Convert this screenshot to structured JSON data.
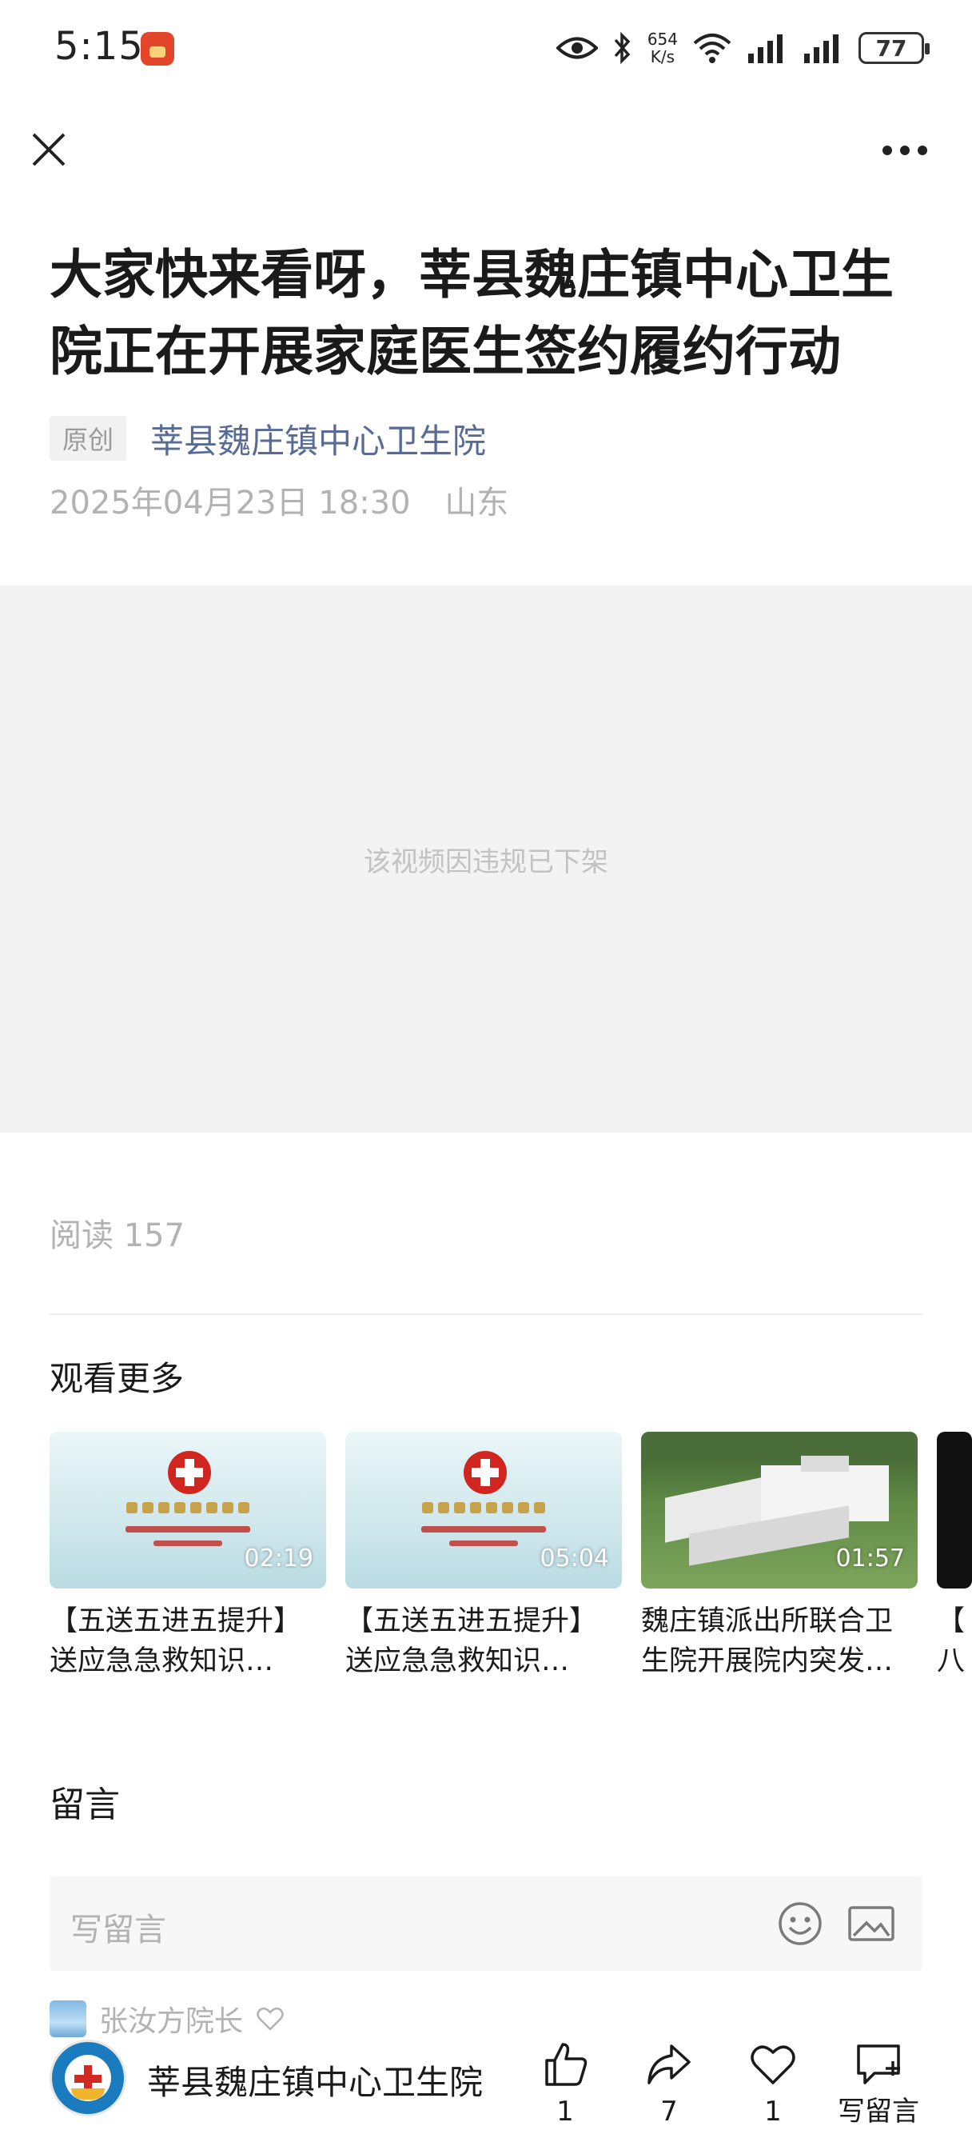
{
  "status_bar": {
    "time": "5:15",
    "net_speed_value": "654",
    "net_speed_unit": "K/s",
    "battery": "77"
  },
  "article": {
    "title_line1": "大家快来看呀，莘县魏庄镇中心卫生",
    "title_line2": "院正在开展家庭医生签约履约行动",
    "original_tag": "原创",
    "account_name": "莘县魏庄镇中心卫生院",
    "date": "2025年04月23日 18:30",
    "location": "山东",
    "video_message": "该视频因违规已下架",
    "read_count": "阅读 157"
  },
  "more_videos": {
    "heading": "观看更多",
    "items": [
      {
        "duration": "02:19",
        "title_line1": "【五送五进五提升】",
        "title_line2": "送应急急救知识…"
      },
      {
        "duration": "05:04",
        "title_line1": "【五送五进五提升】",
        "title_line2": "送应急急救知识…"
      },
      {
        "duration": "01:57",
        "title_line1": "魏庄镇派出所联合卫",
        "title_line2": "生院开展院内突发…"
      },
      {
        "duration": "",
        "title_line1": "【",
        "title_line2": "八"
      }
    ]
  },
  "comments": {
    "heading": "留言",
    "placeholder": "写留言",
    "latest_commenter": "张汝方院长"
  },
  "bottom_bar": {
    "account_name": "莘县魏庄镇中心卫生院",
    "like_count": "1",
    "share_count": "7",
    "favorite_count": "1",
    "write_comment_label": "写留言"
  }
}
